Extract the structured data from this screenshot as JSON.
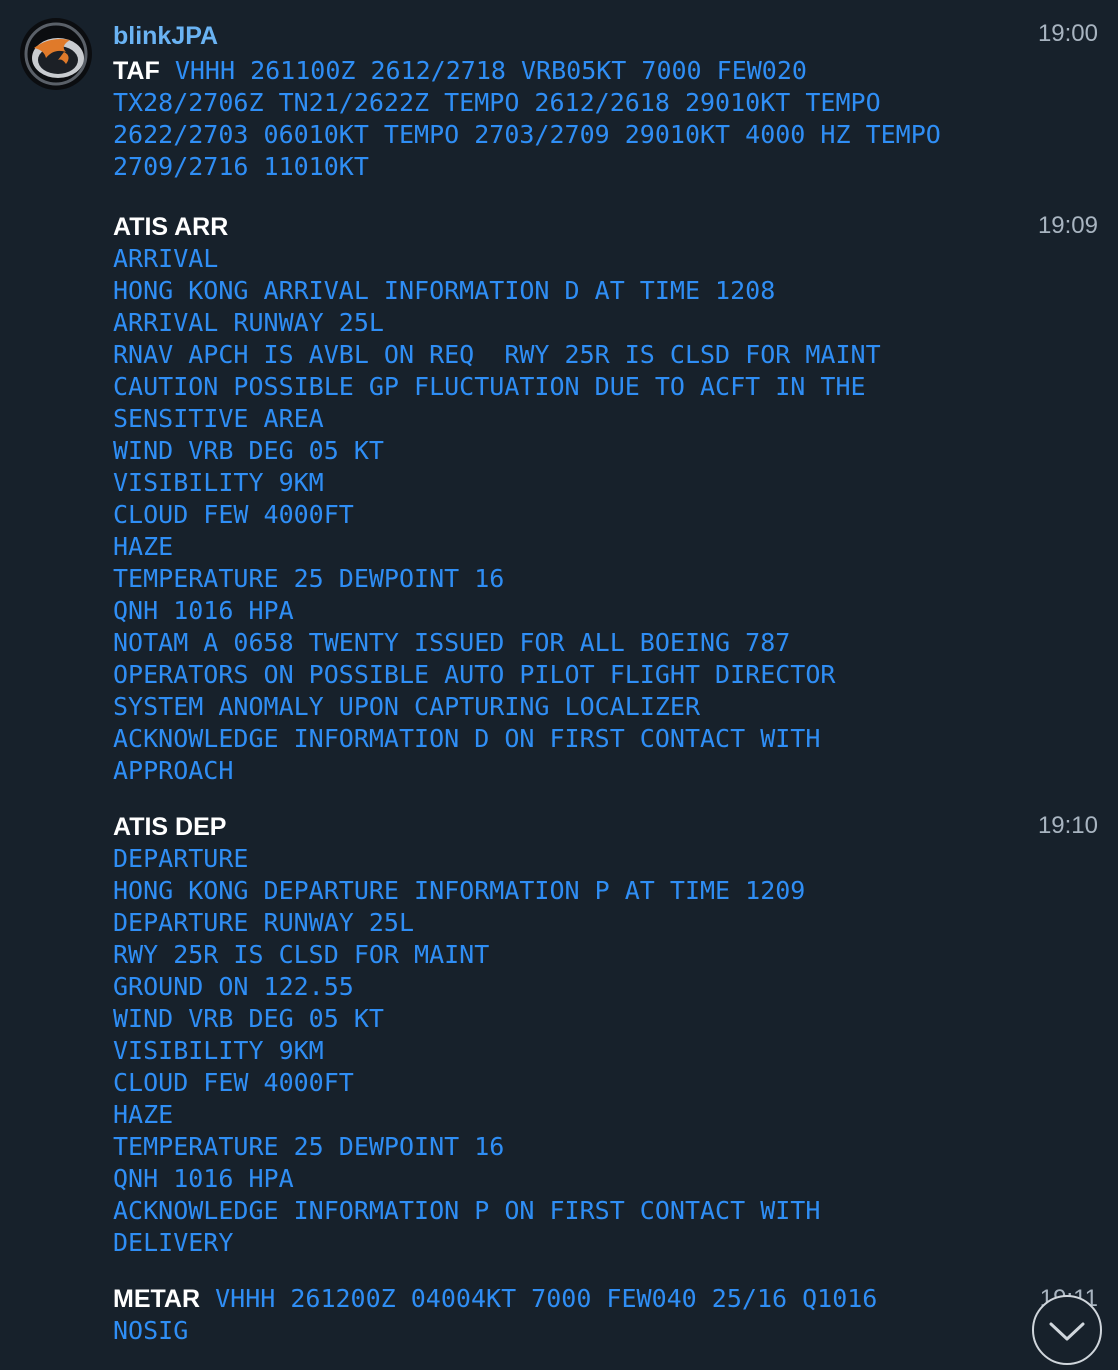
{
  "sender": "blinkJPA",
  "messages": [
    {
      "time": "19:00",
      "head": "TAF",
      "first": "VHHH 261100Z 2612/2718 VRB05KT 7000 FEW020",
      "lines": [
        "TX28/2706Z TN21/2622Z TEMPO 2612/2618 29010KT TEMPO",
        "2622/2703 06010KT TEMPO 2703/2709 29010KT 4000 HZ TEMPO",
        "2709/2716 11010KT"
      ]
    },
    {
      "time": "19:09",
      "head": "ATIS ARR",
      "lines": [
        "ARRIVAL",
        "HONG KONG ARRIVAL INFORMATION D AT TIME 1208",
        "ARRIVAL RUNWAY 25L",
        "RNAV APCH IS AVBL ON REQ  RWY 25R IS CLSD FOR MAINT",
        "CAUTION POSSIBLE GP FLUCTUATION DUE TO ACFT IN THE",
        "SENSITIVE AREA",
        "WIND VRB DEG 05 KT",
        "VISIBILITY 9KM",
        "CLOUD FEW 4000FT",
        "HAZE",
        "TEMPERATURE 25 DEWPOINT 16",
        "QNH 1016 HPA",
        "NOTAM A 0658 TWENTY ISSUED FOR ALL BOEING 787",
        "OPERATORS ON POSSIBLE AUTO PILOT FLIGHT DIRECTOR",
        "SYSTEM ANOMALY UPON CAPTURING LOCALIZER",
        "ACKNOWLEDGE INFORMATION D ON FIRST CONTACT WITH",
        "APPROACH"
      ]
    },
    {
      "time": "19:10",
      "head": "ATIS DEP",
      "lines": [
        "DEPARTURE",
        "HONG KONG DEPARTURE INFORMATION P AT TIME 1209",
        "DEPARTURE RUNWAY 25L",
        "RWY 25R IS CLSD FOR MAINT",
        "GROUND ON 122.55",
        "WIND VRB DEG 05 KT",
        "VISIBILITY 9KM",
        "CLOUD FEW 4000FT",
        "HAZE",
        "TEMPERATURE 25 DEWPOINT 16",
        "QNH 1016 HPA",
        "ACKNOWLEDGE INFORMATION P ON FIRST CONTACT WITH",
        "DELIVERY"
      ]
    },
    {
      "time": "19:11",
      "head": "METAR",
      "first": "VHHH 261200Z 04004KT 7000 FEW040 25/16 Q1016",
      "lines": [
        "NOSIG"
      ]
    }
  ],
  "icons": {
    "avatar": "bird-logo-icon",
    "scroll": "chevron-down-icon"
  },
  "colors": {
    "background": "#17212b",
    "text": "#2f8ef5",
    "sender": "#6ab3f3"
  }
}
